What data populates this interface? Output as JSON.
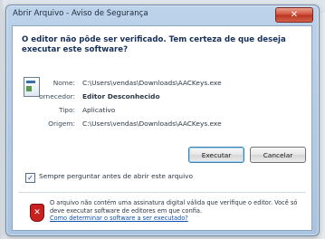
{
  "window": {
    "title": "Abrir Arquivo - Aviso de Segurança",
    "close_glyph": "✕"
  },
  "question": "O editor não pôde ser verificado. Tem certeza de que deseja executar este software?",
  "details": [
    {
      "label": "Nome:",
      "value": "C:\\Users\\vendas\\Downloads\\AACKeys.exe",
      "bold": false
    },
    {
      "label": "ornecedor:",
      "value": "Editor Desconhecido",
      "bold": true
    },
    {
      "label": "Tipo:",
      "value": "Aplicativo",
      "bold": false
    },
    {
      "label": "Origem:",
      "value": "C:\\Users\\vendas\\Downloads\\AACKeys.exe",
      "bold": false
    }
  ],
  "buttons": {
    "run": "Executar",
    "cancel": "Cancelar"
  },
  "always_ask": {
    "label": "Sempre perguntar antes de abrir este arquivo",
    "checked": true,
    "check_glyph": "✓"
  },
  "warning": {
    "text": "O arquivo não contém uma assinatura digital válida que verifique o editor. Você só deve executar software de editores em que confia.",
    "link": "Como determinar o software a ser executado?",
    "icon_glyph": "✕"
  },
  "icons": {
    "app": "application-icon",
    "shield": "security-shield-icon"
  }
}
